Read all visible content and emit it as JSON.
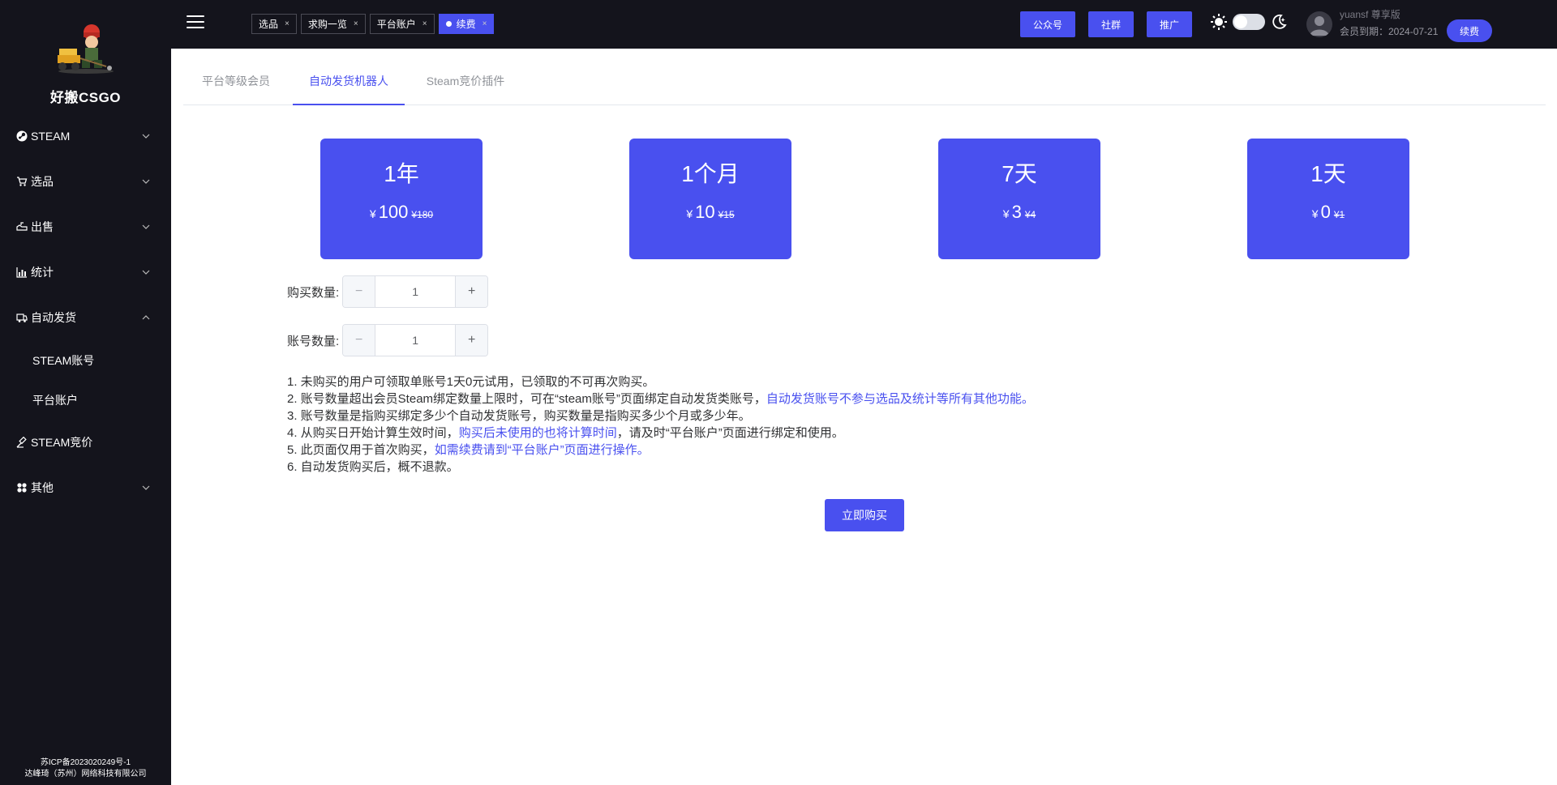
{
  "brand": {
    "name": "好搬CSGO"
  },
  "sidebar": {
    "items": [
      {
        "label": "STEAM",
        "icon": "steam-icon"
      },
      {
        "label": "选品",
        "icon": "cart-icon"
      },
      {
        "label": "出售",
        "icon": "sell-icon"
      },
      {
        "label": "统计",
        "icon": "chart-icon"
      },
      {
        "label": "自动发货",
        "icon": "truck-icon"
      },
      {
        "label": "STEAM竞价",
        "icon": "bid-icon"
      },
      {
        "label": "其他",
        "icon": "grid-icon"
      }
    ],
    "subitems": [
      {
        "label": "STEAM账号"
      },
      {
        "label": "平台账户"
      }
    ],
    "footer": {
      "icp": "苏ICP备2023020249号-1",
      "company": "达峰琦（苏州）网络科技有限公司"
    }
  },
  "topbar": {
    "tags": [
      {
        "label": "选品",
        "close": "×"
      },
      {
        "label": "求购一览",
        "close": "×"
      },
      {
        "label": "平台账户",
        "close": "×"
      },
      {
        "label": "续费",
        "close": "×"
      }
    ],
    "buttons": {
      "official": "公众号",
      "community": "社群",
      "promote": "推广"
    },
    "user": {
      "name": "yuansf  尊享版",
      "expiry": "会员到期：2024-07-21",
      "renew": "续费"
    }
  },
  "tabs": [
    {
      "label": "平台等级会员"
    },
    {
      "label": "自动发货机器人"
    },
    {
      "label": "Steam竞价插件"
    }
  ],
  "plans": [
    {
      "duration": "1年",
      "currency": "¥",
      "price": "100",
      "original": "¥180"
    },
    {
      "duration": "1个月",
      "currency": "¥",
      "price": "10",
      "original": "¥15"
    },
    {
      "duration": "7天",
      "currency": "¥",
      "price": "3",
      "original": "¥4"
    },
    {
      "duration": "1天",
      "currency": "¥",
      "price": "0",
      "original": "¥1"
    }
  ],
  "form": {
    "purchase_qty": {
      "label": "购买数量:",
      "value": "1",
      "minus": "−",
      "plus": "+"
    },
    "account_qty": {
      "label": "账号数量:",
      "value": "1",
      "minus": "−",
      "plus": "+"
    }
  },
  "notes": {
    "n1": "1. 未购买的用户可领取单账号1天0元试用，已领取的不可再次购买。",
    "n2a": "2. 账号数量超出会员Steam绑定数量上限时，可在“steam账号”页面绑定自动发货类账号，",
    "n2b": "自动发货账号不参与选品及统计等所有其他功能。",
    "n3": "3. 账号数量是指购买绑定多少个自动发货账号，购买数量是指购买多少个月或多少年。",
    "n4a": "4. 从购买日开始计算生效时间，",
    "n4b": "购买后未使用的也将计算时间",
    "n4c": "，请及时“平台账户”页面进行绑定和使用。",
    "n5a": "5. 此页面仅用于首次购买，",
    "n5b": "如需续费请到“平台账户”页面进行操作。",
    "n6": "6. 自动发货购买后，概不退款。"
  },
  "buy_button": "立即购买",
  "colors": {
    "accent": "#4950ef",
    "sidebar_bg": "#14141c"
  }
}
